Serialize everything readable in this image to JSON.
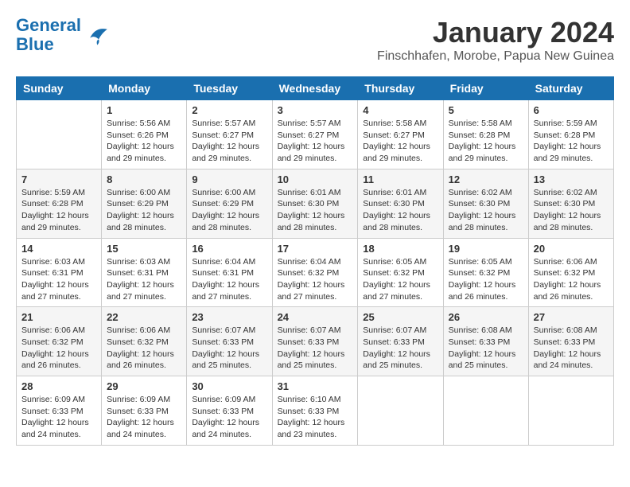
{
  "header": {
    "logo_line1": "General",
    "logo_line2": "Blue",
    "month_year": "January 2024",
    "location": "Finschhafen, Morobe, Papua New Guinea"
  },
  "days_of_week": [
    "Sunday",
    "Monday",
    "Tuesday",
    "Wednesday",
    "Thursday",
    "Friday",
    "Saturday"
  ],
  "weeks": [
    [
      {
        "day": "",
        "content": ""
      },
      {
        "day": "1",
        "content": "Sunrise: 5:56 AM\nSunset: 6:26 PM\nDaylight: 12 hours\nand 29 minutes."
      },
      {
        "day": "2",
        "content": "Sunrise: 5:57 AM\nSunset: 6:27 PM\nDaylight: 12 hours\nand 29 minutes."
      },
      {
        "day": "3",
        "content": "Sunrise: 5:57 AM\nSunset: 6:27 PM\nDaylight: 12 hours\nand 29 minutes."
      },
      {
        "day": "4",
        "content": "Sunrise: 5:58 AM\nSunset: 6:27 PM\nDaylight: 12 hours\nand 29 minutes."
      },
      {
        "day": "5",
        "content": "Sunrise: 5:58 AM\nSunset: 6:28 PM\nDaylight: 12 hours\nand 29 minutes."
      },
      {
        "day": "6",
        "content": "Sunrise: 5:59 AM\nSunset: 6:28 PM\nDaylight: 12 hours\nand 29 minutes."
      }
    ],
    [
      {
        "day": "7",
        "content": "Sunrise: 5:59 AM\nSunset: 6:28 PM\nDaylight: 12 hours\nand 29 minutes."
      },
      {
        "day": "8",
        "content": "Sunrise: 6:00 AM\nSunset: 6:29 PM\nDaylight: 12 hours\nand 28 minutes."
      },
      {
        "day": "9",
        "content": "Sunrise: 6:00 AM\nSunset: 6:29 PM\nDaylight: 12 hours\nand 28 minutes."
      },
      {
        "day": "10",
        "content": "Sunrise: 6:01 AM\nSunset: 6:30 PM\nDaylight: 12 hours\nand 28 minutes."
      },
      {
        "day": "11",
        "content": "Sunrise: 6:01 AM\nSunset: 6:30 PM\nDaylight: 12 hours\nand 28 minutes."
      },
      {
        "day": "12",
        "content": "Sunrise: 6:02 AM\nSunset: 6:30 PM\nDaylight: 12 hours\nand 28 minutes."
      },
      {
        "day": "13",
        "content": "Sunrise: 6:02 AM\nSunset: 6:30 PM\nDaylight: 12 hours\nand 28 minutes."
      }
    ],
    [
      {
        "day": "14",
        "content": "Sunrise: 6:03 AM\nSunset: 6:31 PM\nDaylight: 12 hours\nand 27 minutes."
      },
      {
        "day": "15",
        "content": "Sunrise: 6:03 AM\nSunset: 6:31 PM\nDaylight: 12 hours\nand 27 minutes."
      },
      {
        "day": "16",
        "content": "Sunrise: 6:04 AM\nSunset: 6:31 PM\nDaylight: 12 hours\nand 27 minutes."
      },
      {
        "day": "17",
        "content": "Sunrise: 6:04 AM\nSunset: 6:32 PM\nDaylight: 12 hours\nand 27 minutes."
      },
      {
        "day": "18",
        "content": "Sunrise: 6:05 AM\nSunset: 6:32 PM\nDaylight: 12 hours\nand 27 minutes."
      },
      {
        "day": "19",
        "content": "Sunrise: 6:05 AM\nSunset: 6:32 PM\nDaylight: 12 hours\nand 26 minutes."
      },
      {
        "day": "20",
        "content": "Sunrise: 6:06 AM\nSunset: 6:32 PM\nDaylight: 12 hours\nand 26 minutes."
      }
    ],
    [
      {
        "day": "21",
        "content": "Sunrise: 6:06 AM\nSunset: 6:32 PM\nDaylight: 12 hours\nand 26 minutes."
      },
      {
        "day": "22",
        "content": "Sunrise: 6:06 AM\nSunset: 6:32 PM\nDaylight: 12 hours\nand 26 minutes."
      },
      {
        "day": "23",
        "content": "Sunrise: 6:07 AM\nSunset: 6:33 PM\nDaylight: 12 hours\nand 25 minutes."
      },
      {
        "day": "24",
        "content": "Sunrise: 6:07 AM\nSunset: 6:33 PM\nDaylight: 12 hours\nand 25 minutes."
      },
      {
        "day": "25",
        "content": "Sunrise: 6:07 AM\nSunset: 6:33 PM\nDaylight: 12 hours\nand 25 minutes."
      },
      {
        "day": "26",
        "content": "Sunrise: 6:08 AM\nSunset: 6:33 PM\nDaylight: 12 hours\nand 25 minutes."
      },
      {
        "day": "27",
        "content": "Sunrise: 6:08 AM\nSunset: 6:33 PM\nDaylight: 12 hours\nand 24 minutes."
      }
    ],
    [
      {
        "day": "28",
        "content": "Sunrise: 6:09 AM\nSunset: 6:33 PM\nDaylight: 12 hours\nand 24 minutes."
      },
      {
        "day": "29",
        "content": "Sunrise: 6:09 AM\nSunset: 6:33 PM\nDaylight: 12 hours\nand 24 minutes."
      },
      {
        "day": "30",
        "content": "Sunrise: 6:09 AM\nSunset: 6:33 PM\nDaylight: 12 hours\nand 24 minutes."
      },
      {
        "day": "31",
        "content": "Sunrise: 6:10 AM\nSunset: 6:33 PM\nDaylight: 12 hours\nand 23 minutes."
      },
      {
        "day": "",
        "content": ""
      },
      {
        "day": "",
        "content": ""
      },
      {
        "day": "",
        "content": ""
      }
    ]
  ]
}
